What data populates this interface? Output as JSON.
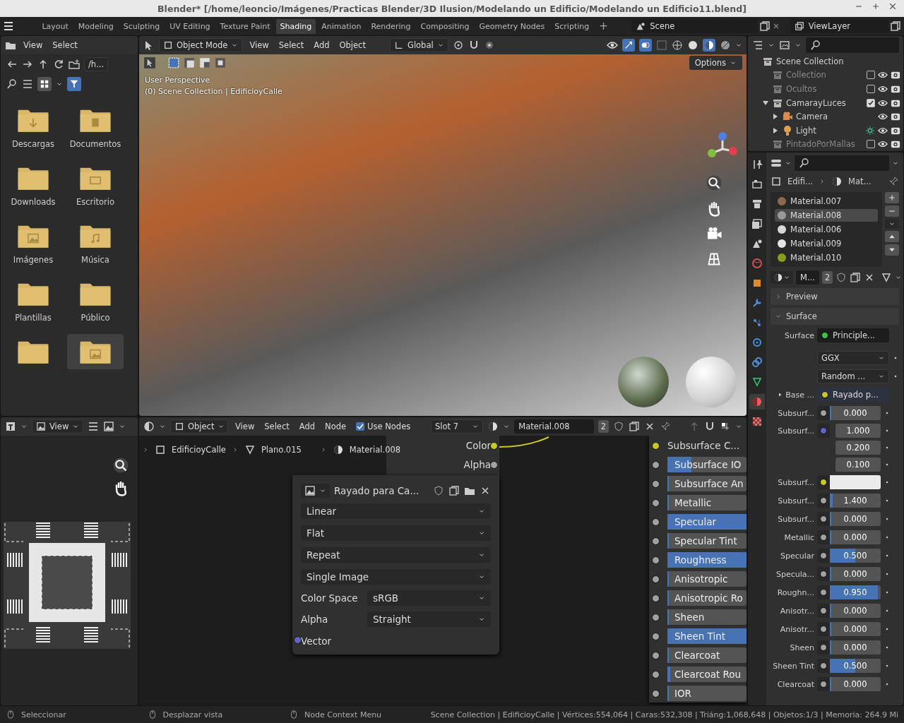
{
  "window": {
    "title": "Blender* [/home/leoncio/Imágenes/Practicas Blender/3D Ilusion/Modelando un Edificio/Modelando un Edificio11.blend]"
  },
  "workspace_tabs": [
    {
      "label": "Layout",
      "selected": false
    },
    {
      "label": "Modeling",
      "selected": false
    },
    {
      "label": "Sculpting",
      "selected": false
    },
    {
      "label": "UV Editing",
      "selected": false
    },
    {
      "label": "Texture Paint",
      "selected": false
    },
    {
      "label": "Shading",
      "selected": true
    },
    {
      "label": "Animation",
      "selected": false
    },
    {
      "label": "Rendering",
      "selected": false
    },
    {
      "label": "Compositing",
      "selected": false
    },
    {
      "label": "Geometry Nodes",
      "selected": false
    },
    {
      "label": "Scripting",
      "selected": false
    }
  ],
  "add_tab": "+",
  "scene": "Scene",
  "view_layer": "ViewLayer",
  "file_browser": {
    "menus": [
      "View",
      "Select"
    ],
    "path": "/h...",
    "folders": [
      {
        "label": "Descargas",
        "kind": "download",
        "selected": false
      },
      {
        "label": "Documentos",
        "kind": "documents",
        "selected": false
      },
      {
        "label": "Downloads",
        "kind": "plain",
        "selected": false
      },
      {
        "label": "Escritorio",
        "kind": "desktop",
        "selected": false
      },
      {
        "label": "Imágenes",
        "kind": "images",
        "selected": false
      },
      {
        "label": "Música",
        "kind": "music",
        "selected": false
      },
      {
        "label": "Plantillas",
        "kind": "plain",
        "selected": false
      },
      {
        "label": "Público",
        "kind": "plain",
        "selected": false
      },
      {
        "kind": "plain",
        "selected": false
      },
      {
        "kind": "images",
        "selected": true
      }
    ]
  },
  "viewport": {
    "mode": "Object Mode",
    "menus": [
      "View",
      "Select",
      "Add",
      "Object"
    ],
    "orientation": "Global",
    "info": [
      "User Perspective",
      "(0) Scene Collection | EdificioyCalle"
    ],
    "options": "Options"
  },
  "outliner": {
    "tree": [
      {
        "label": "Scene Collection",
        "kind": "scene",
        "children": [
          {
            "label": "Collection",
            "kind": "collection",
            "checked": false
          },
          {
            "label": "Ocultos",
            "kind": "collection",
            "checked": false
          },
          {
            "label": "CamarayLuces",
            "kind": "collection",
            "checked": true,
            "expanded": true,
            "children": [
              {
                "label": "Camera",
                "kind": "camera",
                "expanded": false
              },
              {
                "label": "Light",
                "kind": "light",
                "expanded": false
              }
            ]
          },
          {
            "label": "PintadoPorMallas",
            "kind": "collection",
            "checked": false
          }
        ]
      }
    ]
  },
  "properties": {
    "tabs": [
      {
        "kind": "tool",
        "selected": false
      },
      {
        "kind": "render",
        "selected": false
      },
      {
        "kind": "output",
        "selected": false
      },
      {
        "kind": "view",
        "selected": false
      },
      {
        "kind": "scene",
        "selected": false
      },
      {
        "kind": "world",
        "selected": false
      },
      {
        "kind": "object",
        "selected": false
      },
      {
        "kind": "modifier",
        "selected": false
      },
      {
        "kind": "particles",
        "selected": false
      },
      {
        "kind": "physics",
        "selected": false
      },
      {
        "kind": "constraints",
        "selected": false
      },
      {
        "kind": "data",
        "selected": false
      },
      {
        "kind": "material",
        "selected": true
      },
      {
        "kind": "texture",
        "selected": false
      }
    ],
    "breadcrumb": [
      "Edifi...",
      "Mat..."
    ],
    "materials": [
      {
        "name": "Material.007",
        "color": "#8a6a4e",
        "selected": false
      },
      {
        "name": "Material.008",
        "color": "#9a9a9a",
        "selected": true
      },
      {
        "name": "Material.006",
        "color": "#d8d8d8",
        "selected": false
      },
      {
        "name": "Material.009",
        "color": "#e4e4e4",
        "selected": false
      },
      {
        "name": "Material.010",
        "color": "#8c9a20",
        "selected": false
      }
    ],
    "slot_name": "M...",
    "users": "2",
    "panels": [
      {
        "label": "Preview",
        "expanded": false
      },
      {
        "label": "Surface",
        "expanded": true
      }
    ],
    "surface_label": "Surface",
    "surface": "Principle...",
    "distribution": "GGX",
    "subsurface_method": "Random ...",
    "base_color": {
      "label": "Base ...",
      "value": "Rayado p..."
    },
    "inputs": [
      {
        "label": "Subsurf...",
        "kind": "float",
        "value": "0.000",
        "level": 0
      },
      {
        "label": "Subsurf...",
        "kind": "vector",
        "values": [
          "1.000",
          "0.200",
          "0.100"
        ]
      },
      {
        "label": "Subsurf...",
        "kind": "color",
        "color": "#ebebeb"
      },
      {
        "label": "Subsurf...",
        "kind": "float",
        "value": "1.400",
        "level": 0.06
      },
      {
        "label": "Subsurf...",
        "kind": "float",
        "value": "0.000",
        "level": 0
      },
      {
        "label": "Metallic",
        "kind": "float",
        "value": "0.000",
        "level": 0
      },
      {
        "label": "Specular",
        "kind": "float",
        "value": "0.500",
        "level": 0.5
      },
      {
        "label": "Specula...",
        "kind": "float",
        "value": "0.000",
        "level": 0
      },
      {
        "label": "Roughn...",
        "kind": "float",
        "value": "0.950",
        "level": 0.95
      },
      {
        "label": "Anisotr...",
        "kind": "float",
        "value": "0.000",
        "level": 0
      },
      {
        "label": "Anisotr...",
        "kind": "float",
        "value": "0.000",
        "level": 0
      },
      {
        "label": "Sheen",
        "kind": "float",
        "value": "0.000",
        "level": 0
      },
      {
        "label": "Sheen Tint",
        "kind": "float",
        "value": "0.500",
        "level": 0.5
      },
      {
        "label": "Clearcoat",
        "kind": "float",
        "value": "0.000",
        "level": 0
      }
    ]
  },
  "image_editor": {
    "menu": "View"
  },
  "node_editor": {
    "mode": "Object",
    "menus": [
      "View",
      "Select",
      "Add",
      "Node"
    ],
    "use_nodes": {
      "label": "Use Nodes",
      "checked": true
    },
    "slot": "Slot 7",
    "material": "Material.008",
    "users": "2",
    "breadcrumb": [
      "EdificioyCalle",
      "Plano.015",
      "Material.008"
    ],
    "image_node": {
      "outputs": [
        {
          "label": "Color",
          "kind": "color"
        },
        {
          "label": "Alpha",
          "kind": "float"
        }
      ],
      "image": "Rayado para Ca...",
      "dropdowns": [
        "Linear",
        "Flat",
        "Repeat",
        "Single Image"
      ],
      "props": [
        {
          "label": "Color Space",
          "value": "sRGB"
        },
        {
          "label": "Alpha",
          "value": "Straight"
        }
      ],
      "inputs": [
        {
          "label": "Vector",
          "kind": "vector"
        }
      ]
    },
    "bsdf_node": {
      "inputs": [
        {
          "label": "Subsurface C...",
          "kind": "color"
        },
        {
          "label": "Subsurface IO",
          "kind": "float",
          "level": 0.3
        },
        {
          "label": "Subsurface An",
          "kind": "float",
          "level": 0
        },
        {
          "label": "Metallic",
          "kind": "float",
          "level": 0
        },
        {
          "label": "Specular",
          "kind": "float",
          "level": 1
        },
        {
          "label": "Specular Tint",
          "kind": "float",
          "level": 0
        },
        {
          "label": "Roughness",
          "kind": "float",
          "level": 1
        },
        {
          "label": "Anisotropic",
          "kind": "float",
          "level": 0
        },
        {
          "label": "Anisotropic Ro",
          "kind": "float",
          "level": 0
        },
        {
          "label": "Sheen",
          "kind": "float",
          "level": 0
        },
        {
          "label": "Sheen Tint",
          "kind": "float",
          "level": 1
        },
        {
          "label": "Clearcoat",
          "kind": "float",
          "level": 0
        },
        {
          "label": "Clearcoat Rou",
          "kind": "float",
          "level": 0.04
        },
        {
          "label": "IOR",
          "kind": "float",
          "level": 0
        }
      ]
    }
  },
  "status_bar": {
    "hints": [
      "Seleccionar",
      "Desplazar vista",
      "Node Context Menu"
    ],
    "stats": "Scene Collection | EdificioyCalle | Vértices:554,064 | Caras:532,308 | Triáng:1,068,648 | Objetos:1/3 | Memoria: 264.9 Mi"
  }
}
